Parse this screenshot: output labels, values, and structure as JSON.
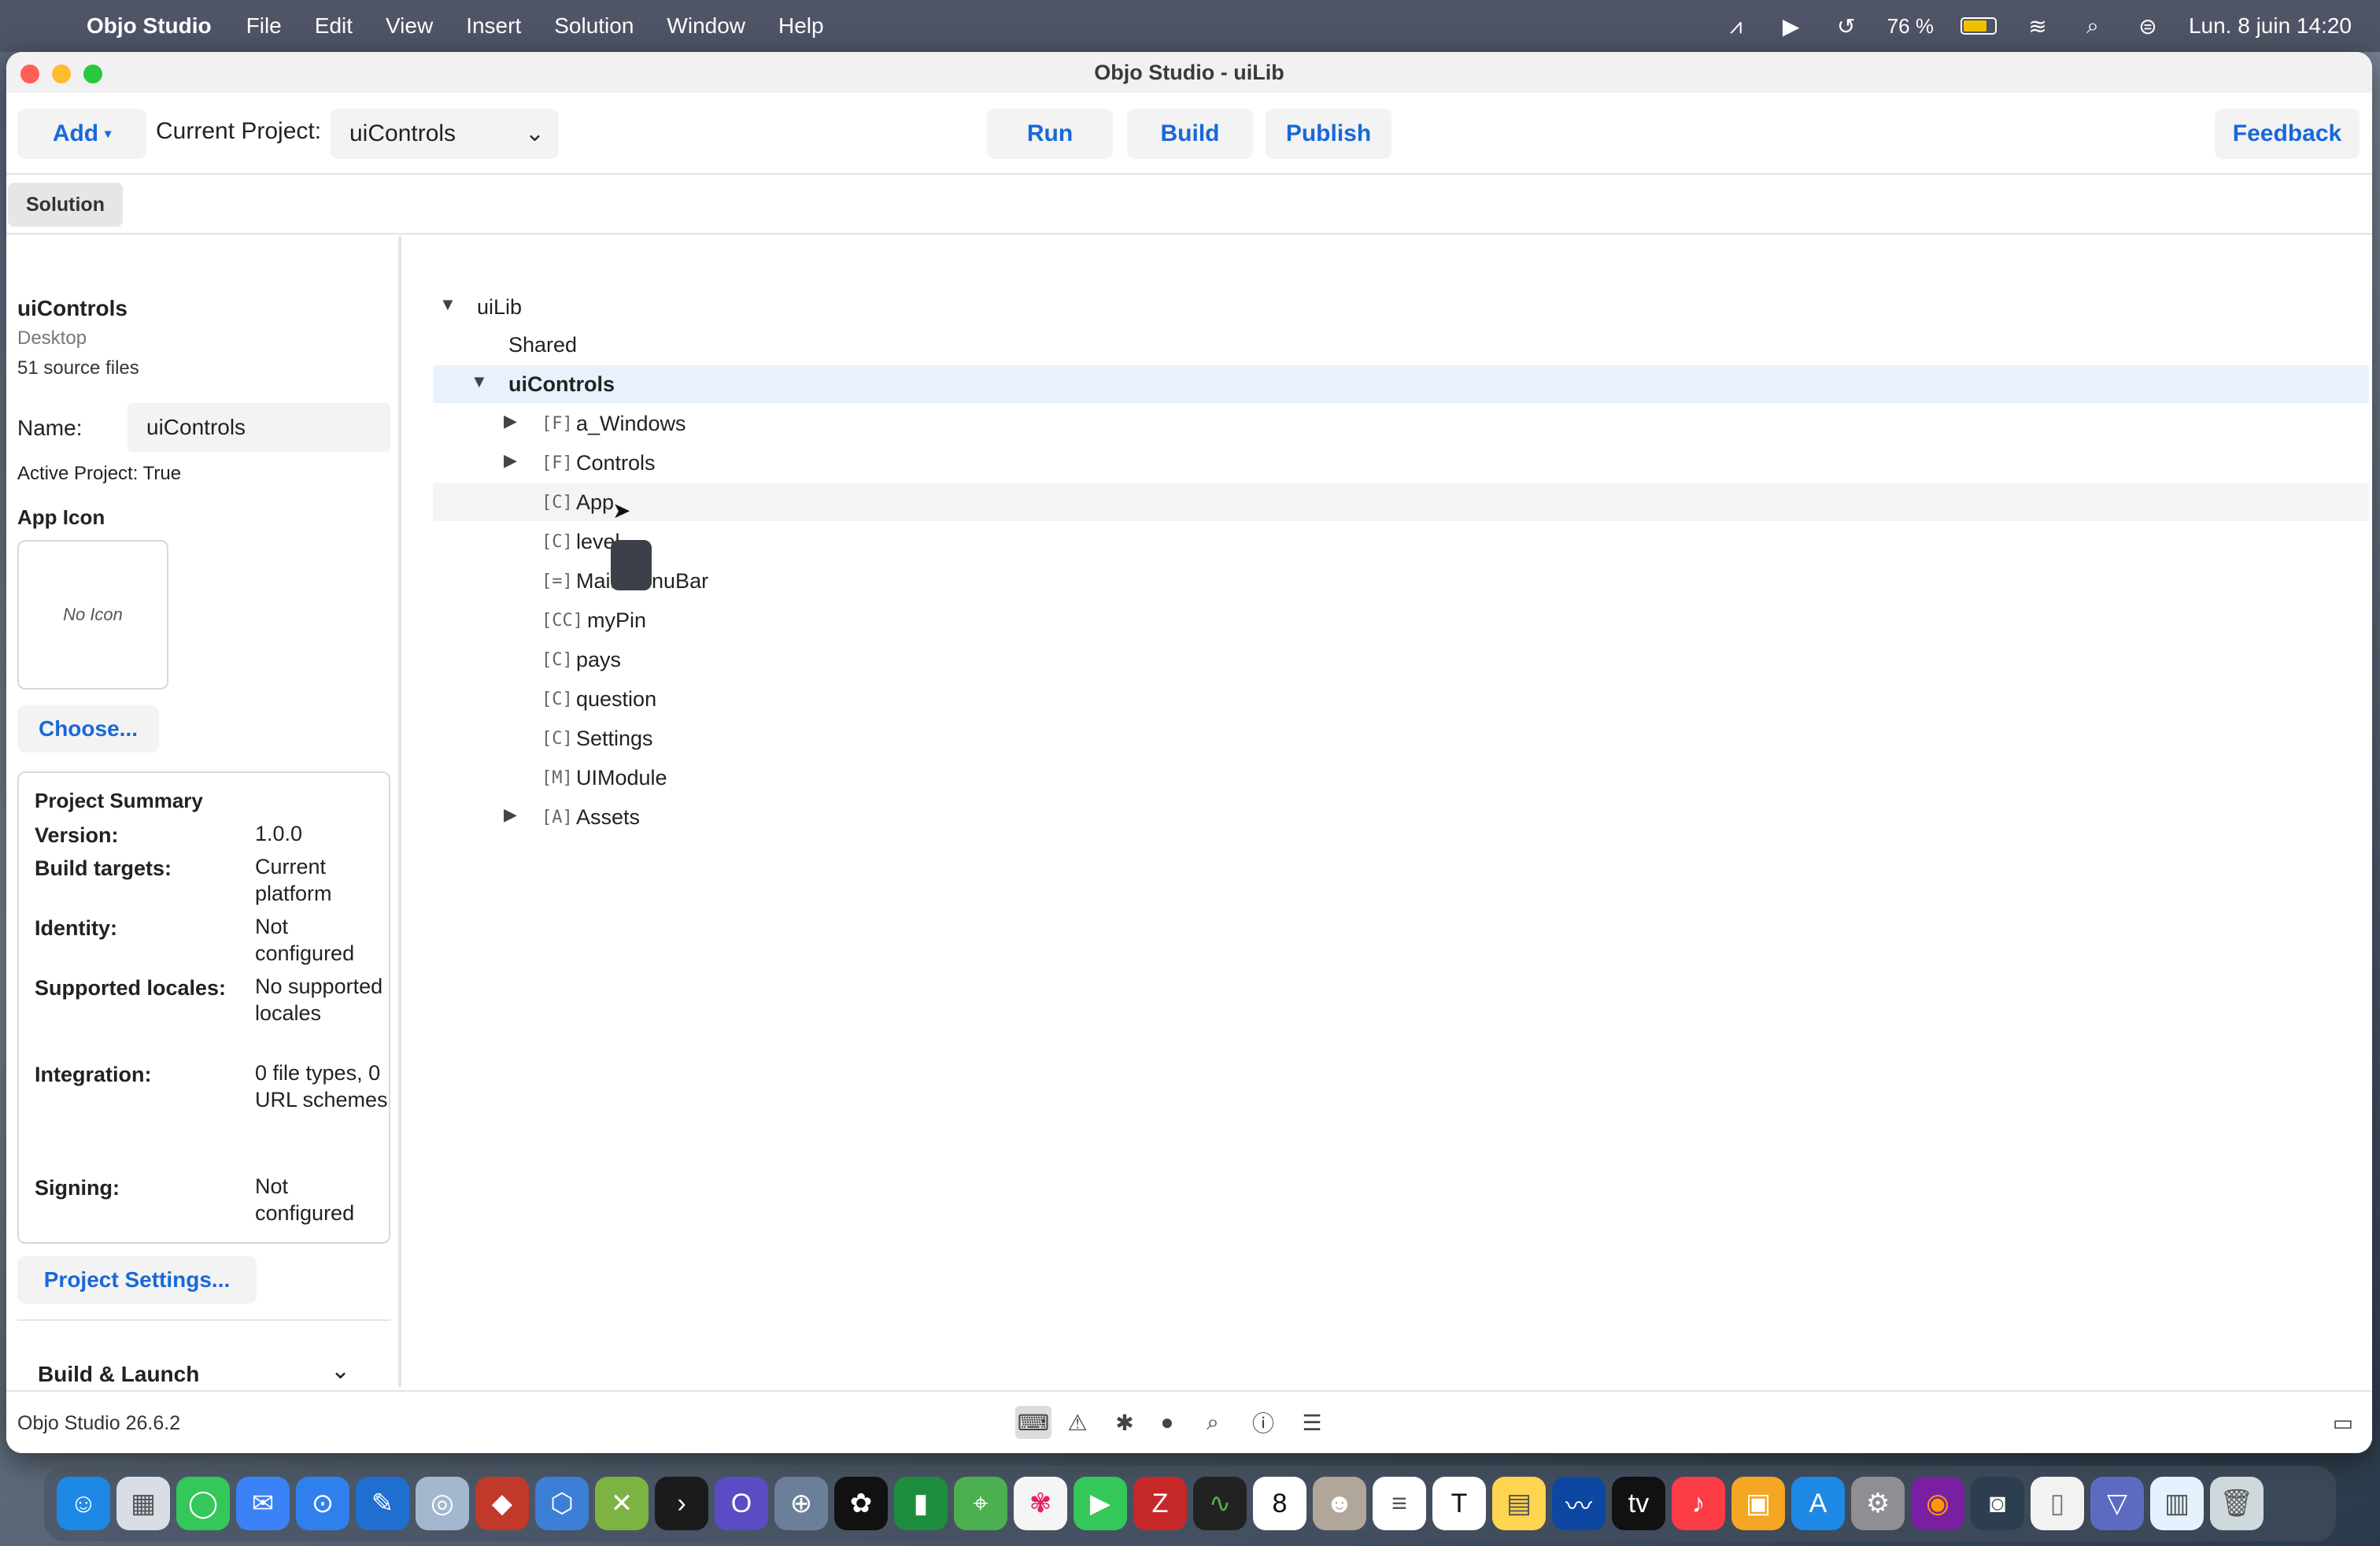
{
  "menubar": {
    "app_name": "Objo Studio",
    "items": [
      "File",
      "Edit",
      "View",
      "Insert",
      "Solution",
      "Window",
      "Help"
    ],
    "battery_percent": "76 %",
    "battery_level": 0.76,
    "date_time": "Lun. 8 juin  14:20"
  },
  "window": {
    "title": "Objo Studio - uiLib"
  },
  "toolbar": {
    "add_label": "Add",
    "current_project_label": "Current Project:",
    "current_project_value": "uiControls",
    "run_label": "Run",
    "build_label": "Build",
    "publish_label": "Publish",
    "feedback_label": "Feedback"
  },
  "tabs": {
    "solution": "Solution"
  },
  "project": {
    "title": "uiControls",
    "platform": "Desktop",
    "source_files": "51 source files",
    "name_label": "Name:",
    "name_value": "uiControls",
    "active_project": "Active Project: True",
    "app_icon_label": "App Icon",
    "no_icon": "No Icon",
    "choose_label": "Choose...",
    "summary": {
      "title": "Project Summary",
      "rows": [
        {
          "key": "Version:",
          "value": "1.0.0"
        },
        {
          "key": "Build targets:",
          "value": "Current platform"
        },
        {
          "key": "Identity:",
          "value": "Not configured"
        },
        {
          "key": "Supported locales:",
          "value": "No supported locales"
        },
        {
          "key": "Integration:",
          "value": "0 file types, 0 URL schemes"
        },
        {
          "key": "Signing:",
          "value": "Not configured"
        }
      ]
    },
    "settings_label": "Project Settings...",
    "build_launch_label": "Build & Launch"
  },
  "tree": {
    "items": [
      {
        "tag": "",
        "label": "uiLib",
        "disclosure": "expanded"
      },
      {
        "tag": "",
        "label": "Shared",
        "disclosure": "none"
      },
      {
        "tag": "",
        "label": "uiControls",
        "disclosure": "expanded"
      },
      {
        "tag": "[F]",
        "label": "a_Windows",
        "disclosure": "collapsed"
      },
      {
        "tag": "[F]",
        "label": "Controls",
        "disclosure": "collapsed"
      },
      {
        "tag": "[C]",
        "label": "App",
        "disclosure": "none"
      },
      {
        "tag": "[C]",
        "label": "level",
        "disclosure": "none"
      },
      {
        "tag": "[=]",
        "label": "MainMenuBar",
        "disclosure": "none"
      },
      {
        "tag": "[CC]",
        "label": "myPin",
        "disclosure": "none"
      },
      {
        "tag": "[C]",
        "label": "pays",
        "disclosure": "none"
      },
      {
        "tag": "[C]",
        "label": "question",
        "disclosure": "none"
      },
      {
        "tag": "[C]",
        "label": "Settings",
        "disclosure": "none"
      },
      {
        "tag": "[M]",
        "label": "UIModule",
        "disclosure": "none"
      },
      {
        "tag": "[A]",
        "label": "Assets",
        "disclosure": "collapsed"
      }
    ]
  },
  "statusbar": {
    "version": "Objo Studio 26.6.2",
    "icons": [
      "terminal-icon",
      "warning-icon",
      "bug-icon",
      "record-icon",
      "search-icon",
      "info-icon",
      "list-icon"
    ]
  },
  "dock": {
    "icons": [
      "finder-icon",
      "launchpad-icon",
      "messages-icon",
      "mail-icon",
      "safari-icon",
      "xcode-icon",
      "preview-icon",
      "app-icon",
      "box-icon",
      "xbox-icon",
      "terminal-icon",
      "objo-icon",
      "network-icon",
      "chatgpt-icon",
      "numbers-icon",
      "maps-icon",
      "photos-icon",
      "facetime-icon",
      "filezilla-icon",
      "activity-monitor-icon",
      "calendar-icon",
      "contacts-icon",
      "reminders-icon",
      "typora-icon",
      "notes-icon",
      "freeform-icon",
      "appletv-icon",
      "music-icon",
      "forms-icon",
      "appstore-icon",
      "system-settings-icon",
      "firefox-icon",
      "finder-disk-icon",
      "document-icon",
      "downloads-icon",
      "files-icon",
      "trash-icon"
    ],
    "calendar_day": "8"
  }
}
